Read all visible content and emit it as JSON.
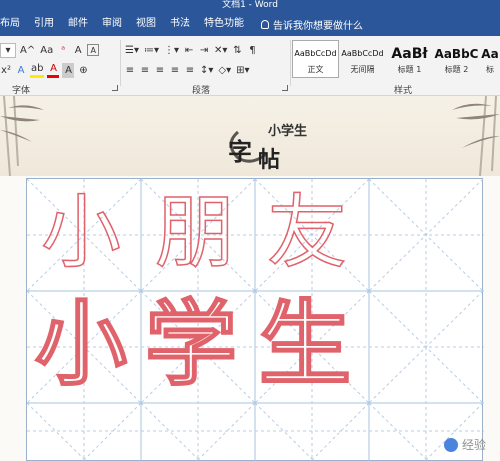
{
  "window": {
    "title": "文档1 - Word"
  },
  "tabs": [
    "布局",
    "引用",
    "邮件",
    "审阅",
    "视图",
    "书法",
    "特色功能"
  ],
  "tell_me": {
    "placeholder": "告诉我你想要做什么"
  },
  "ribbon": {
    "font_size_grow_label": "A^",
    "change_case_label": "Aa",
    "clear_format_label": "A",
    "groups": {
      "font": "字体",
      "paragraph": "段落",
      "styles": "样式"
    }
  },
  "styles": [
    {
      "sample": "AaBbCcDd",
      "name": "正文",
      "active": true
    },
    {
      "sample": "AaBbCcDd",
      "name": "无间隔",
      "active": false
    },
    {
      "sample": "AaBł",
      "name": "标题 1",
      "active": false
    },
    {
      "sample": "AaBbC",
      "name": "标题 2",
      "active": false
    },
    {
      "sample": "Aa",
      "name": "标",
      "active": false
    }
  ],
  "logo": {
    "text_top": "小学生",
    "text_main1": "字",
    "text_main2": "帖"
  },
  "practice": {
    "row1": [
      "小",
      "朋",
      "友"
    ],
    "row2": [
      "小",
      "学",
      "生"
    ]
  },
  "colors": {
    "ribbon_blue": "#2b579a",
    "outline_red": "#e0626a",
    "grid_blue": "#a9c3df"
  },
  "watermark": {
    "text": "经验"
  }
}
